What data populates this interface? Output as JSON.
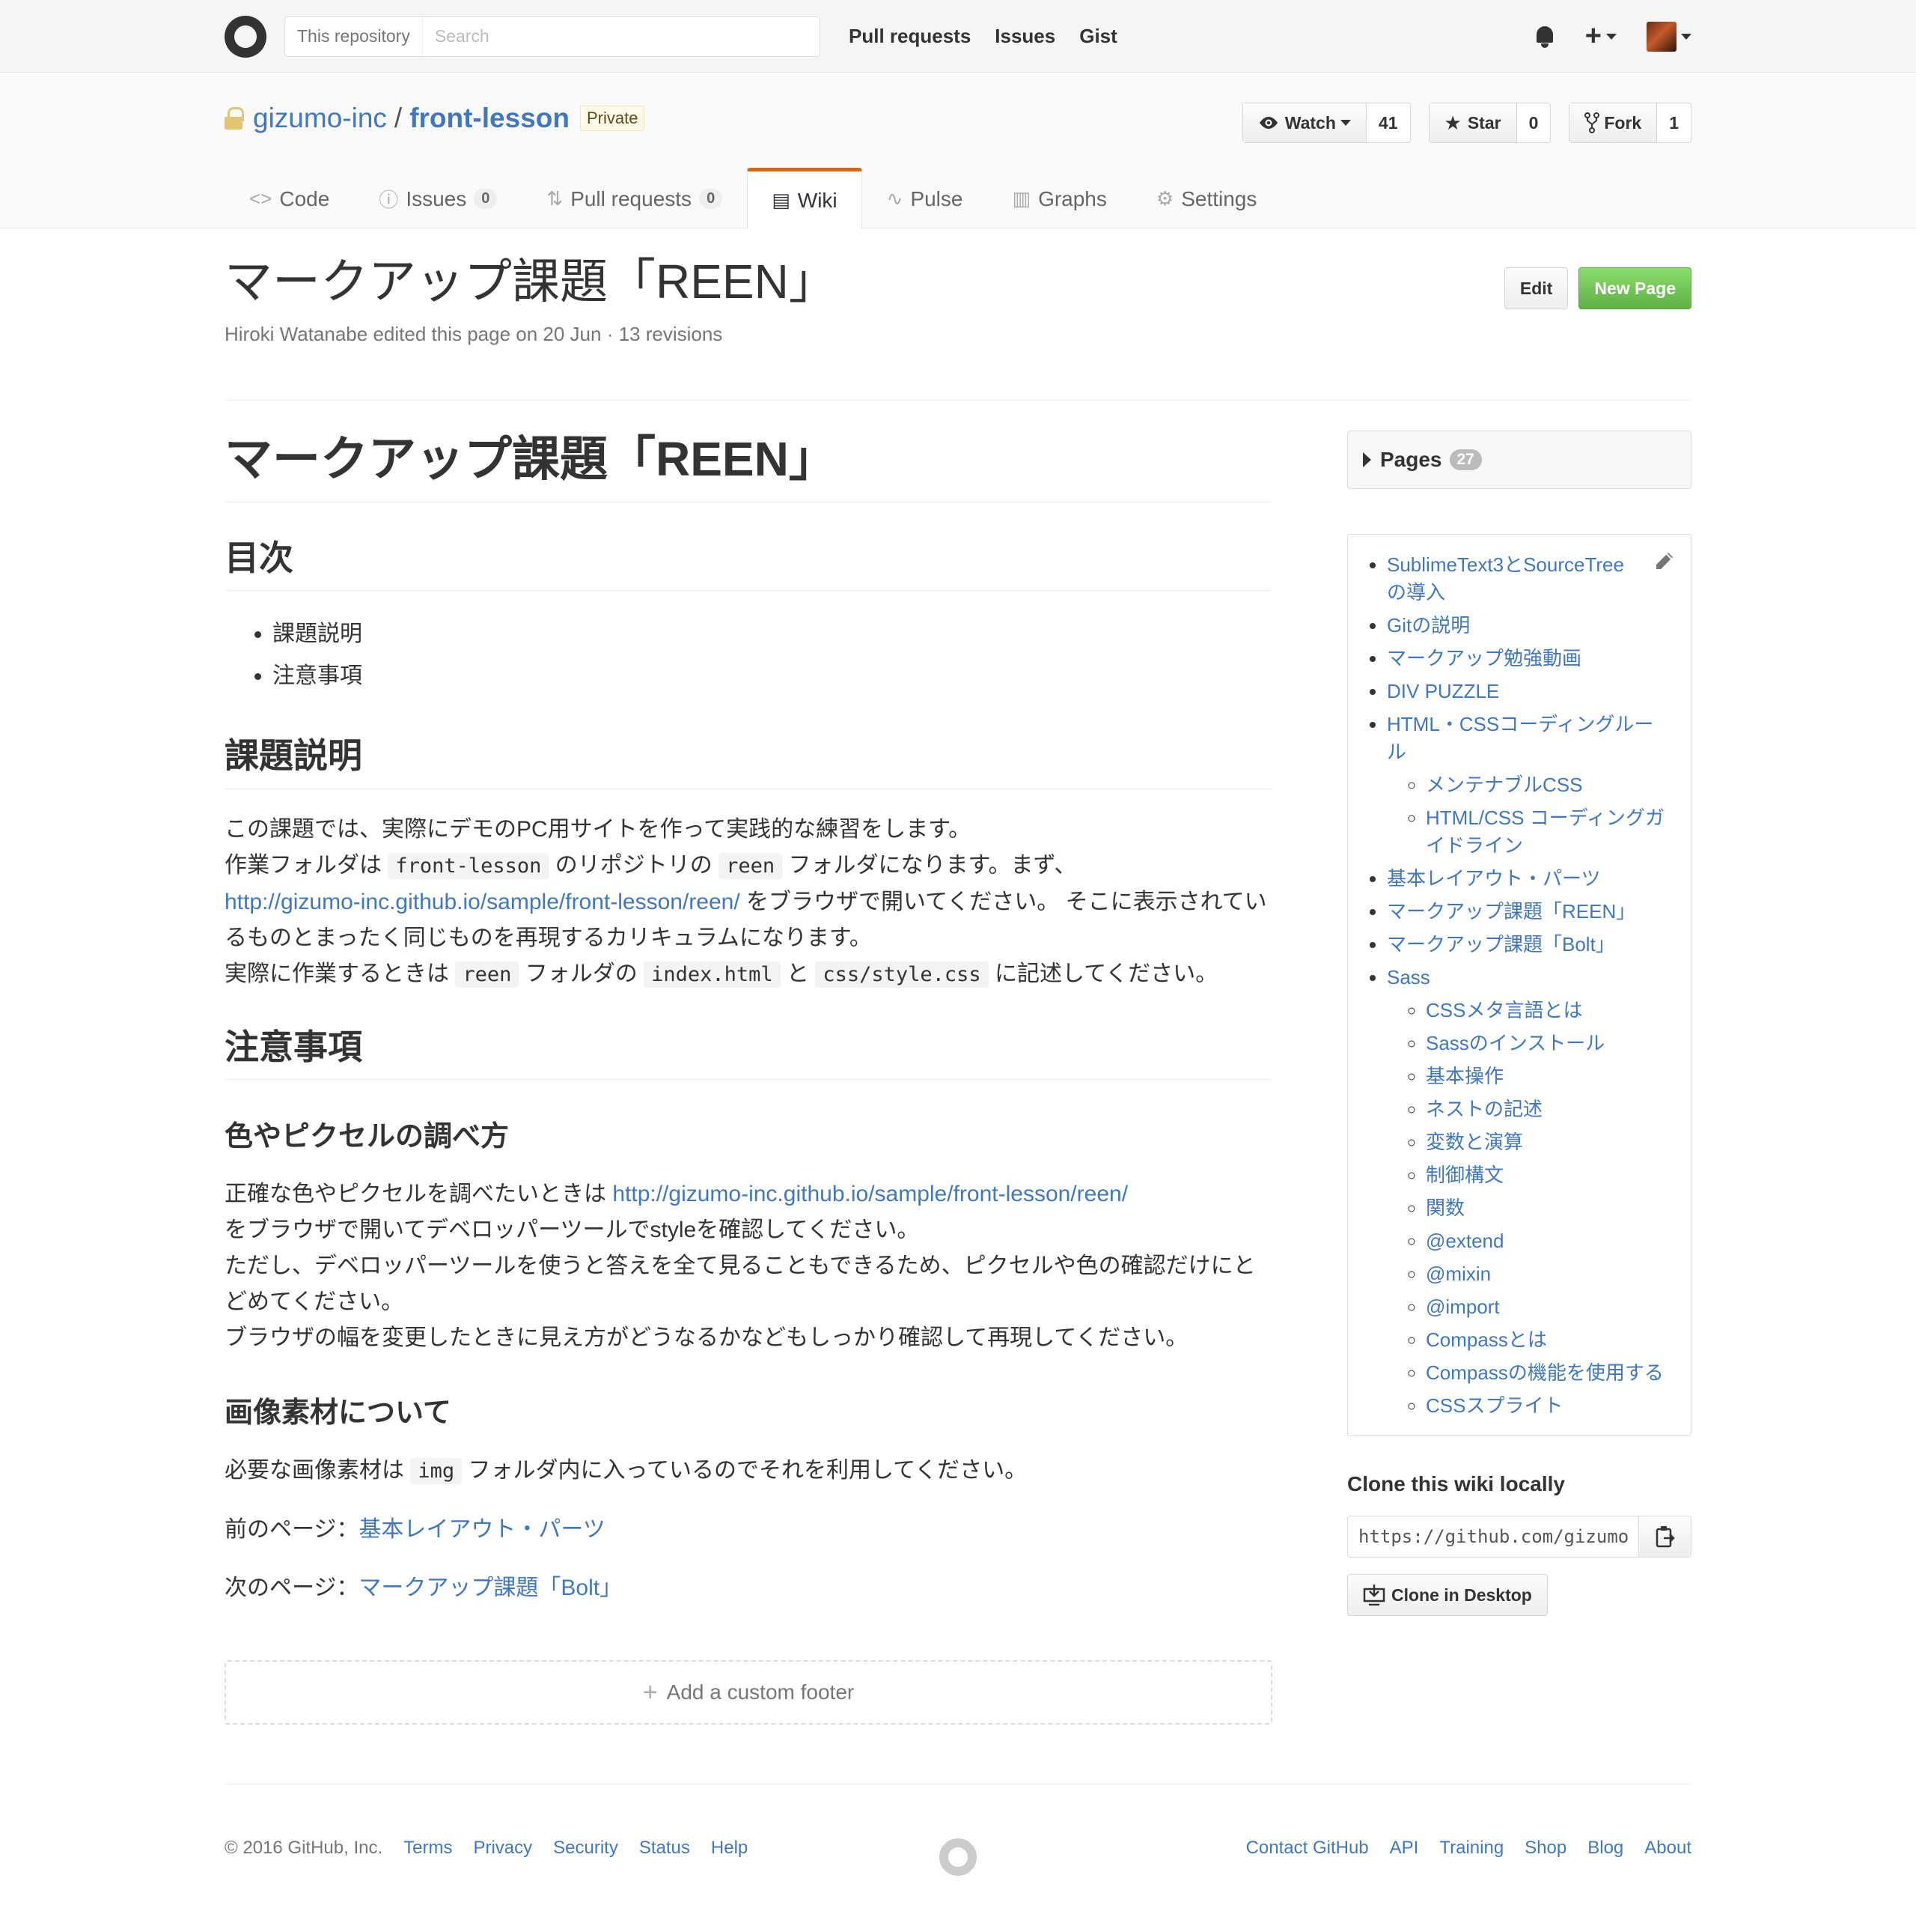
{
  "header": {
    "search_scope": "This repository",
    "search_placeholder": "Search",
    "nav": [
      "Pull requests",
      "Issues",
      "Gist"
    ]
  },
  "repo": {
    "owner": "gizumo-inc",
    "name": "front-lesson",
    "visibility": "Private",
    "watch_label": "Watch",
    "watch_count": "41",
    "star_label": "Star",
    "star_count": "0",
    "fork_label": "Fork",
    "fork_count": "1"
  },
  "tabs": [
    {
      "label": "Code",
      "icon": "code-icon"
    },
    {
      "label": "Issues",
      "count": "0",
      "icon": "issue-icon"
    },
    {
      "label": "Pull requests",
      "count": "0",
      "icon": "pull-request-icon"
    },
    {
      "label": "Wiki",
      "icon": "book-icon",
      "active": true
    },
    {
      "label": "Pulse",
      "icon": "pulse-icon"
    },
    {
      "label": "Graphs",
      "icon": "graph-icon"
    },
    {
      "label": "Settings",
      "icon": "gear-icon"
    }
  ],
  "wiki": {
    "title": "マークアップ課題「REEN」",
    "meta": "Hiroki Watanabe edited this page on 20 Jun · 13 revisions",
    "edit_label": "Edit",
    "new_page_label": "New Page"
  },
  "content": {
    "h1": "マークアップ課題「REEN」",
    "toc_heading": "目次",
    "toc": [
      "課題説明",
      "注意事項"
    ],
    "section1_heading": "課題説明",
    "p1_line1": "この課題では、実際にデモのPC用サイトを作って実践的な練習をします。",
    "p1_a": "作業フォルダは",
    "p1_code1": "front-lesson",
    "p1_b": "のリポジトリの",
    "p1_code2": "reen",
    "p1_c": "フォルダになります。まず、",
    "p1_link": "http://gizumo-inc.github.io/sample/front-lesson/reen/",
    "p1_d": "をブラウザで開いてください。 そこに表示されているものとまったく同じものを再現するカリキュラムになります。",
    "p1_e": "実際に作業するときは",
    "p1_code3": "reen",
    "p1_f": "フォルダの",
    "p1_code4": "index.html",
    "p1_g": "と",
    "p1_code5": "css/style.css",
    "p1_h": "に記述してください。",
    "section2_heading": "注意事項",
    "sub1_heading": "色やピクセルの調べ方",
    "p2_a": "正確な色やピクセルを調べたいときは",
    "p2_link": "http://gizumo-inc.github.io/sample/front-lesson/reen/",
    "p2_b": "をブラウザで開いてデベロッパーツールでstyleを確認してください。",
    "p2_c": "ただし、デベロッパーツールを使うと答えを全て見ることもできるため、ピクセルや色の確認だけにとどめてください。",
    "p2_d": "ブラウザの幅を変更したときに見え方がどうなるかなどもしっかり確認して再現してください。",
    "sub2_heading": "画像素材について",
    "p3_a": "必要な画像素材は",
    "p3_code": "img",
    "p3_b": "フォルダ内に入っているのでそれを利用してください。",
    "prev_label": "前のページ：",
    "prev_link": "基本レイアウト・パーツ",
    "next_label": "次のページ：",
    "next_link": "マークアップ課題「Bolt」",
    "custom_footer": "Add a custom footer"
  },
  "sidebar": {
    "pages_label": "Pages",
    "pages_count": "27",
    "nav": [
      "SublimeText3とSourceTreeの導入",
      "Gitの説明",
      "マークアップ勉強動画",
      "DIV PUZZLE",
      "HTML・CSSコーディングルール",
      "基本レイアウト・パーツ",
      "マークアップ課題「REEN」",
      "マークアップ課題「Bolt」",
      "Sass"
    ],
    "nav_html_children": [
      "メンテナブルCSS",
      "HTML/CSS コーディングガイドライン"
    ],
    "nav_sass_children": [
      "CSSメタ言語とは",
      "Sassのインストール",
      "基本操作",
      "ネストの記述",
      "変数と演算",
      "制御構文",
      "関数",
      "@extend",
      "@mixin",
      "@import",
      "Compassとは",
      "Compassの機能を使用する",
      "CSSスプライト"
    ],
    "clone_heading": "Clone this wiki locally",
    "clone_url": "https://github.com/gizumo",
    "clone_desktop": "Clone in Desktop"
  },
  "footer": {
    "copyright": "© 2016 GitHub, Inc.",
    "left_links": [
      "Terms",
      "Privacy",
      "Security",
      "Status",
      "Help"
    ],
    "right_links": [
      "Contact GitHub",
      "API",
      "Training",
      "Shop",
      "Blog",
      "About"
    ]
  }
}
